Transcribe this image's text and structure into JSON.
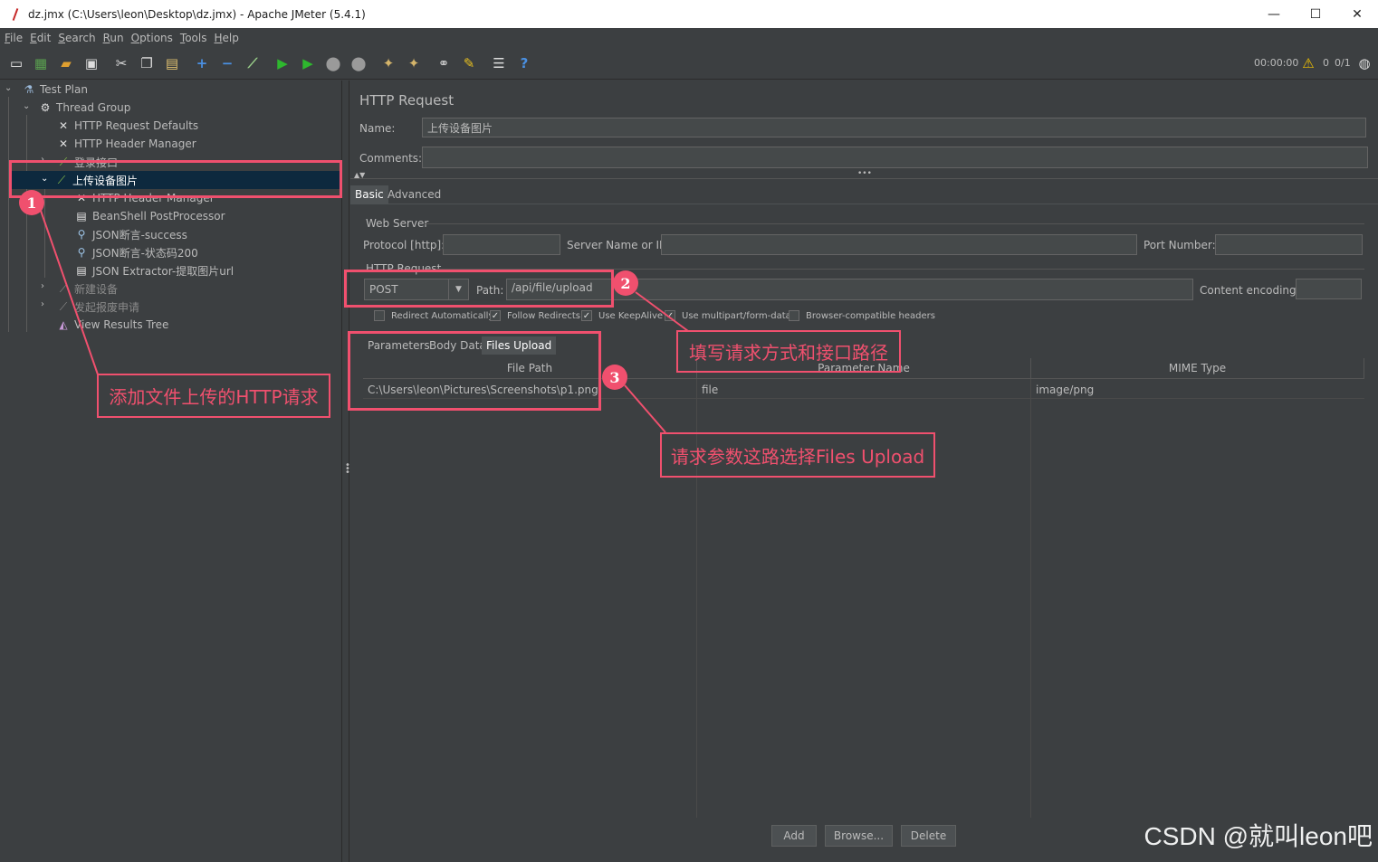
{
  "window": {
    "title": "dz.jmx (C:\\Users\\leon\\Desktop\\dz.jmx) - Apache JMeter (5.4.1)",
    "minimize": "—",
    "maximize": "☐",
    "close": "✕"
  },
  "menu": [
    "File",
    "Edit",
    "Search",
    "Run",
    "Options",
    "Tools",
    "Help"
  ],
  "toolbar": {
    "timer": "00:00:00",
    "warnings": "0",
    "threads": "0/1"
  },
  "tree": {
    "test_plan": "Test Plan",
    "thread_group": "Thread Group",
    "http_defaults": "HTTP Request Defaults",
    "header_manager": "HTTP Header Manager",
    "login": "登录接口",
    "upload": "上传设备图片",
    "child_header_manager": "HTTP Header Manager",
    "beanshell": "BeanShell PostProcessor",
    "json_assert1": "JSON断言-success",
    "json_assert2": "JSON断言-状态码200",
    "json_extractor": "JSON Extractor-提取图片url",
    "new_device": "新建设备",
    "apply_scrap": "发起报废申请",
    "results_tree": "View Results Tree"
  },
  "panel": {
    "heading": "HTTP Request",
    "name_label": "Name:",
    "name_value": "上传设备图片",
    "comments_label": "Comments:",
    "comments_value": "",
    "tabs": [
      "Basic",
      "Advanced"
    ],
    "web_server": "Web Server",
    "protocol_label": "Protocol [http]:",
    "server_label": "Server Name or IP:",
    "port_label": "Port Number:",
    "http_request": "HTTP Request",
    "method": "POST",
    "path_label": "Path:",
    "path_value": "/api/file/upload",
    "encoding_label": "Content encoding:",
    "checks": [
      {
        "label": "Redirect Automatically",
        "checked": false
      },
      {
        "label": "Follow Redirects",
        "checked": true
      },
      {
        "label": "Use KeepAlive",
        "checked": true
      },
      {
        "label": "Use multipart/form-data",
        "checked": true
      },
      {
        "label": "Browser-compatible headers",
        "checked": false
      }
    ],
    "param_tabs": [
      "Parameters",
      "Body Data",
      "Files Upload"
    ],
    "columns": [
      "File Path",
      "Parameter Name",
      "MIME Type"
    ],
    "rows": [
      {
        "path": "C:\\Users\\leon\\Pictures\\Screenshots\\p1.png",
        "param": "file",
        "mime": "image/png"
      }
    ],
    "buttons": [
      "Add",
      "Browse...",
      "Delete"
    ]
  },
  "annotations": {
    "badge1": "1",
    "badge2": "2",
    "badge3": "3",
    "note1": "添加文件上传的HTTP请求",
    "note2": "填写请求方式和接口路径",
    "note3": "请求参数这路选择Files Upload",
    "watermark": "CSDN @就叫leon吧"
  },
  "colors": {
    "annotation": "#f0506e",
    "selection": "#0d293e",
    "background": "#3c3f41"
  }
}
